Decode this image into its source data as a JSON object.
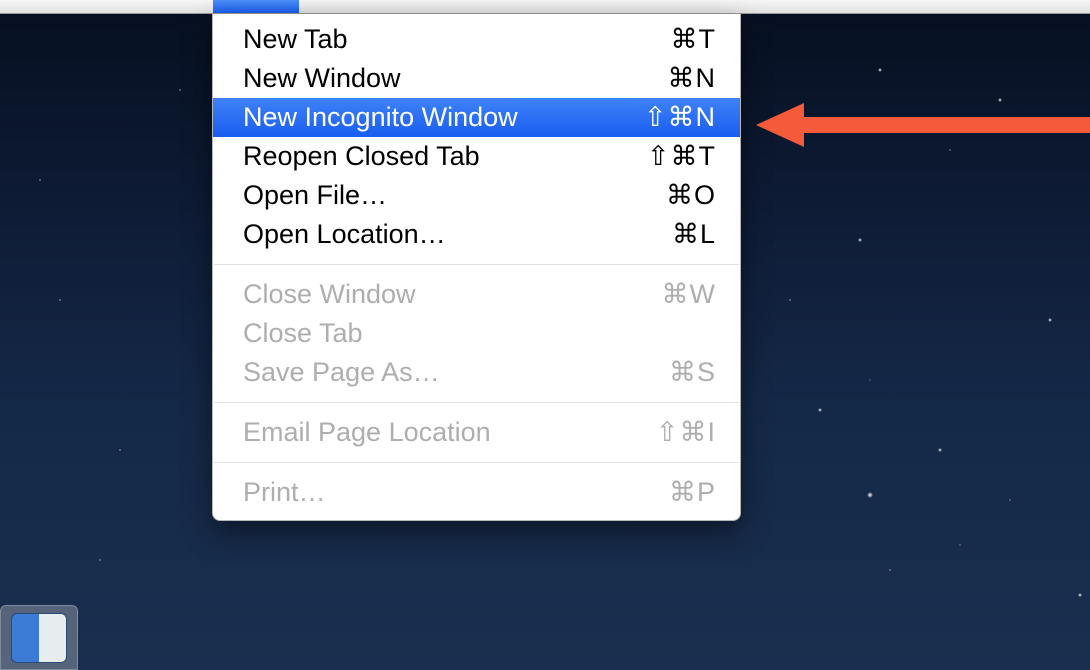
{
  "menu": {
    "groups": [
      [
        {
          "label": "New Tab",
          "shortcut": "⌘T",
          "enabled": true,
          "highlight": false
        },
        {
          "label": "New Window",
          "shortcut": "⌘N",
          "enabled": true,
          "highlight": false
        },
        {
          "label": "New Incognito Window",
          "shortcut": "⇧⌘N",
          "enabled": true,
          "highlight": true
        },
        {
          "label": "Reopen Closed Tab",
          "shortcut": "⇧⌘T",
          "enabled": true,
          "highlight": false
        },
        {
          "label": "Open File…",
          "shortcut": "⌘O",
          "enabled": true,
          "highlight": false
        },
        {
          "label": "Open Location…",
          "shortcut": "⌘L",
          "enabled": true,
          "highlight": false
        }
      ],
      [
        {
          "label": "Close Window",
          "shortcut": "⌘W",
          "enabled": false,
          "highlight": false
        },
        {
          "label": "Close Tab",
          "shortcut": "",
          "enabled": false,
          "highlight": false
        },
        {
          "label": "Save Page As…",
          "shortcut": "⌘S",
          "enabled": false,
          "highlight": false
        }
      ],
      [
        {
          "label": "Email Page Location",
          "shortcut": "⇧⌘I",
          "enabled": false,
          "highlight": false
        }
      ],
      [
        {
          "label": "Print…",
          "shortcut": "⌘P",
          "enabled": false,
          "highlight": false
        }
      ]
    ]
  },
  "annotation": {
    "arrow_color": "#f55a3a"
  }
}
